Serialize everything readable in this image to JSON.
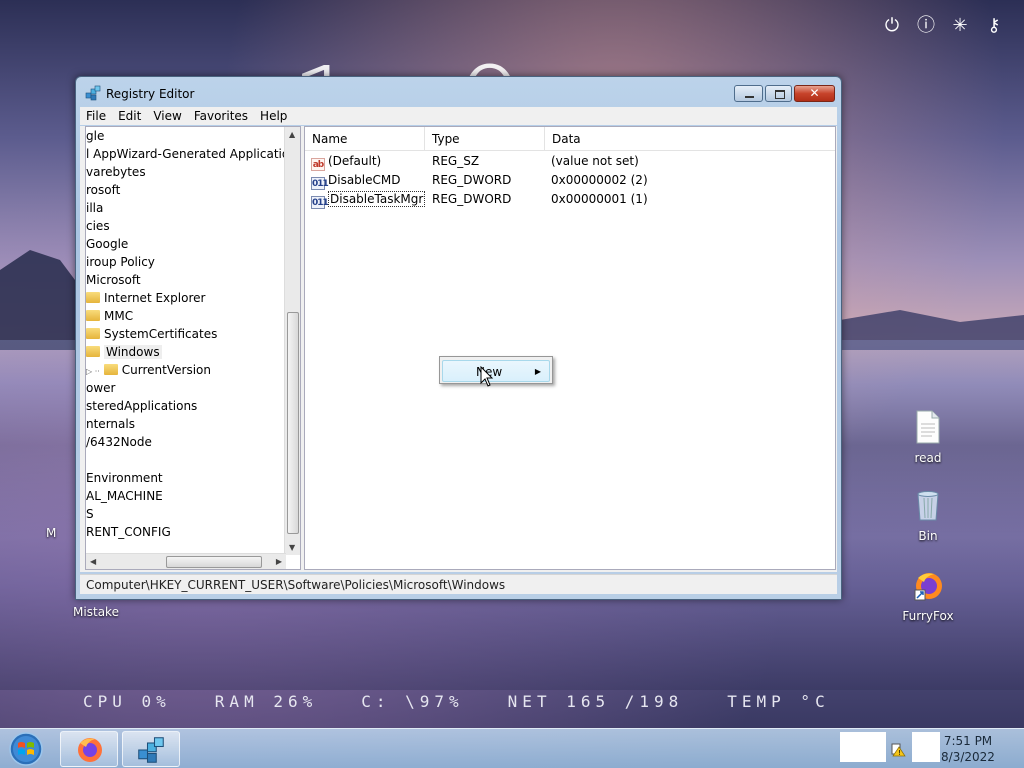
{
  "desktop": {
    "big_clock": "1 0 5 1",
    "stats": {
      "cpu": "CPU 0%",
      "ram": "RAM 26%",
      "disk": "C: \\97%",
      "net": "NET 165 /198",
      "temp": "TEMP °C"
    },
    "icons": [
      {
        "label": "read",
        "icon": "text-file-icon"
      },
      {
        "label": "Bin",
        "icon": "recycle-bin-icon"
      },
      {
        "label": "FurryFox",
        "icon": "firefox-icon"
      },
      {
        "label": "Mistake",
        "icon": ""
      }
    ],
    "sys_icons": [
      "power-icon",
      "info-icon",
      "loading-icon",
      "key-icon"
    ]
  },
  "window": {
    "title": "Registry Editor",
    "menu": [
      "File",
      "Edit",
      "View",
      "Favorites",
      "Help"
    ],
    "tree": [
      {
        "label": "gle",
        "indent": 0,
        "folder": false
      },
      {
        "label": "l AppWizard-Generated Applications",
        "indent": 0,
        "folder": false
      },
      {
        "label": "varebytes",
        "indent": 0,
        "folder": false
      },
      {
        "label": "rosoft",
        "indent": 0,
        "folder": false
      },
      {
        "label": "illa",
        "indent": 0,
        "folder": false
      },
      {
        "label": "cies",
        "indent": 0,
        "folder": false
      },
      {
        "label": "Google",
        "indent": 0,
        "folder": false
      },
      {
        "label": "iroup Policy",
        "indent": 0,
        "folder": false
      },
      {
        "label": "Microsoft",
        "indent": 0,
        "folder": false
      },
      {
        "label": "Internet Explorer",
        "indent": 1,
        "folder": true
      },
      {
        "label": "MMC",
        "indent": 1,
        "folder": true
      },
      {
        "label": "SystemCertificates",
        "indent": 1,
        "folder": true
      },
      {
        "label": "Windows",
        "indent": 1,
        "folder": true,
        "selected": true
      },
      {
        "label": "CurrentVersion",
        "indent": 2,
        "folder": true,
        "expander": true
      },
      {
        "label": "ower",
        "indent": 0,
        "folder": false
      },
      {
        "label": "steredApplications",
        "indent": 0,
        "folder": false
      },
      {
        "label": "nternals",
        "indent": 0,
        "folder": false
      },
      {
        "label": "/6432Node",
        "indent": 0,
        "folder": false
      },
      {
        "label": "",
        "indent": 0,
        "folder": false
      },
      {
        "label": "Environment",
        "indent": 0,
        "folder": false
      },
      {
        "label": "AL_MACHINE",
        "indent": 0,
        "folder": false
      },
      {
        "label": "S",
        "indent": 0,
        "folder": false
      },
      {
        "label": "RENT_CONFIG",
        "indent": 0,
        "folder": false
      }
    ],
    "columns": [
      "Name",
      "Type",
      "Data"
    ],
    "values": [
      {
        "name": "(Default)",
        "type": "REG_SZ",
        "data": "(value not set)",
        "icon": "ab"
      },
      {
        "name": "DisableCMD",
        "type": "REG_DWORD",
        "data": "0x00000002 (2)",
        "icon": "011"
      },
      {
        "name": "DisableTaskMgr",
        "type": "REG_DWORD",
        "data": "0x00000001 (1)",
        "icon": "011"
      }
    ],
    "status_path": "Computer\\HKEY_CURRENT_USER\\Software\\Policies\\Microsoft\\Windows",
    "context_menu": {
      "item": "New"
    }
  },
  "taskbar": {
    "time": "7:51 PM",
    "date": "8/3/2022"
  }
}
